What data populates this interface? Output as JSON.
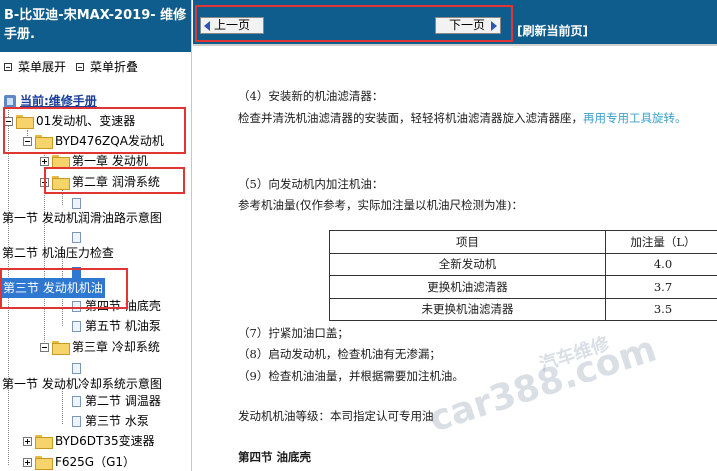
{
  "left": {
    "title_line1": "B-比亚迪-宋MAX-2019- 维修",
    "title_line2": "手册.",
    "expand_label": "菜单展开",
    "collapse_label": "菜单折叠",
    "root_label": "当前:维修手册",
    "items": [
      "01发动机、变速器",
      "BYD476ZQA发动机",
      "第一章 发动机",
      "第二章 润滑系统",
      "第一节 发动机润滑油路示意图",
      "第二节 机油压力检查",
      "第三节 发动机机油",
      "第四节 油底壳",
      "第五节 机油泵",
      "第三章 冷却系统",
      "第一节 发动机冷却系统示意图",
      "第二节 调温器",
      "第三节 水泵",
      "BYD6DT35变速器",
      "F625G（G1）"
    ]
  },
  "nav": {
    "prev_label": "上一页",
    "next_label": "下一页",
    "refresh_label": "[刷新当前页]"
  },
  "content": {
    "step4_title": "（4）安装新的机油滤清器：",
    "step4_text": "检查并清洗机油滤清器的安装面，轻轻将机油滤清器旋入滤清器座，",
    "step4_highlight": "再用专用工具旋转。",
    "step5_title": "（5）向发动机内加注机油：",
    "step5_text": "参考机油量(仅作参考，实际加注量以机油尺检测为准)：",
    "table": {
      "header": [
        "项目",
        "加注量（L）"
      ],
      "rows": [
        [
          "全新发动机",
          "4.0"
        ],
        [
          "更换机油滤清器",
          "3.7"
        ],
        [
          "未更换机油滤清器",
          "3.5"
        ]
      ]
    },
    "step7": "（7）拧紧加油口盖；",
    "step8": "（8）启动发动机，检查机油有无渗漏；",
    "step9": "（9）检查机油油量，并根据需要加注机油。",
    "grade_text": "发动机机油等级：本司指定认可专用油",
    "section4": "第四节 油底壳"
  },
  "watermark": {
    "text1": "car388.com",
    "text2": "汽车维修"
  },
  "colors": {
    "header_bg": "#0f5d8c",
    "selection": "#2f78d1",
    "highlight_text": "#3aa0c8",
    "annotation_red": "#e13434"
  }
}
